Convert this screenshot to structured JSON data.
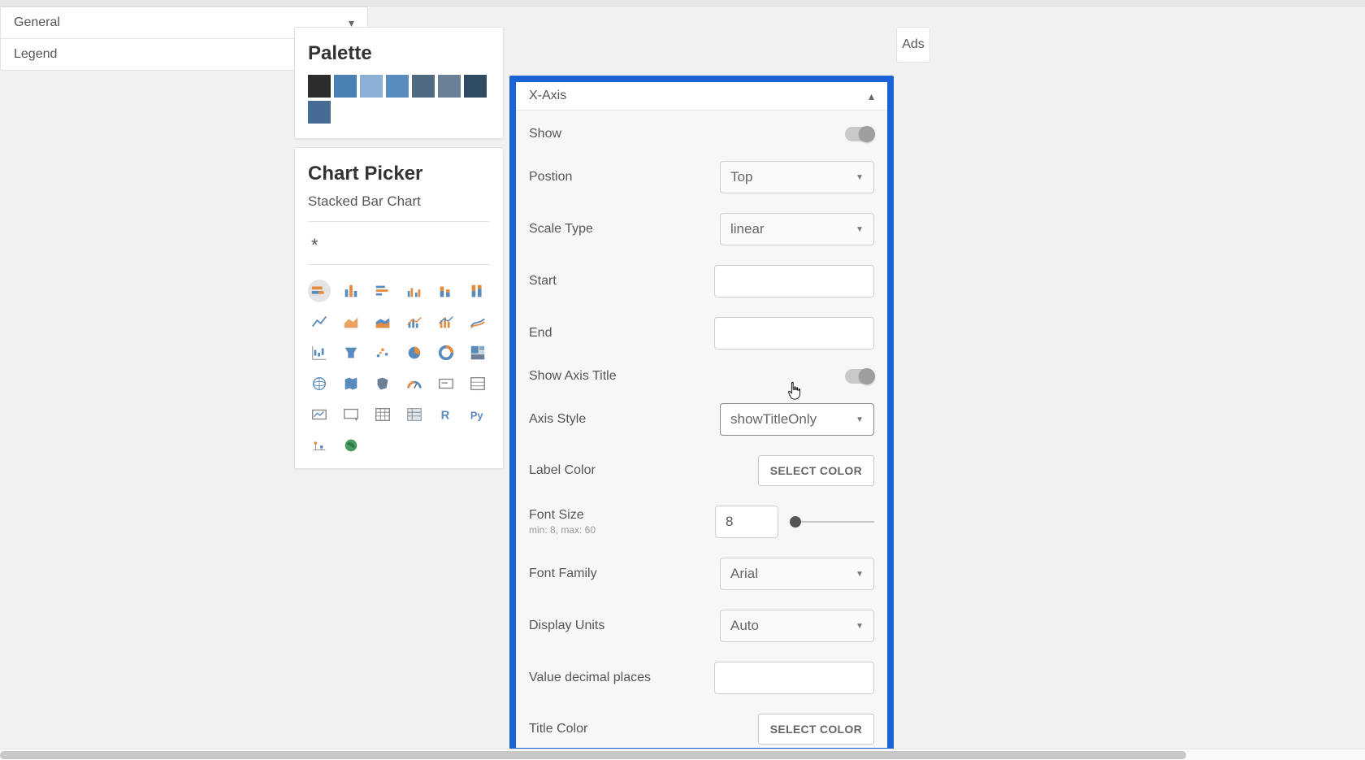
{
  "palette": {
    "title": "Palette",
    "colors": [
      "#2c2c2c",
      "#4b80b4",
      "#8ab0d6",
      "#5a8bbd",
      "#516a82",
      "#6b7f96",
      "#2f4a63",
      "#456c95"
    ]
  },
  "chartPicker": {
    "title": "Chart Picker",
    "subtitle": "Stacked Bar Chart",
    "star": "*"
  },
  "accordion": {
    "general": "General",
    "legend": "Legend",
    "xaxis": "X-Axis"
  },
  "xaxis": {
    "show": "Show",
    "position": "Postion",
    "position_value": "Top",
    "scaleType": "Scale Type",
    "scaleType_value": "linear",
    "start": "Start",
    "start_value": "",
    "end": "End",
    "end_value": "",
    "showAxisTitle": "Show Axis Title",
    "axisStyle": "Axis Style",
    "axisStyle_value": "showTitleOnly",
    "labelColor": "Label Color",
    "selectColor": "SELECT COLOR",
    "fontSize": "Font Size",
    "fontSize_hint": "min: 8, max: 60",
    "fontSize_value": "8",
    "fontFamily": "Font Family",
    "fontFamily_value": "Arial",
    "displayUnits": "Display Units",
    "displayUnits_value": "Auto",
    "valueDecimals": "Value decimal places",
    "valueDecimals_value": "",
    "titleColor": "Title Color"
  },
  "ads": {
    "label": "Ads"
  }
}
